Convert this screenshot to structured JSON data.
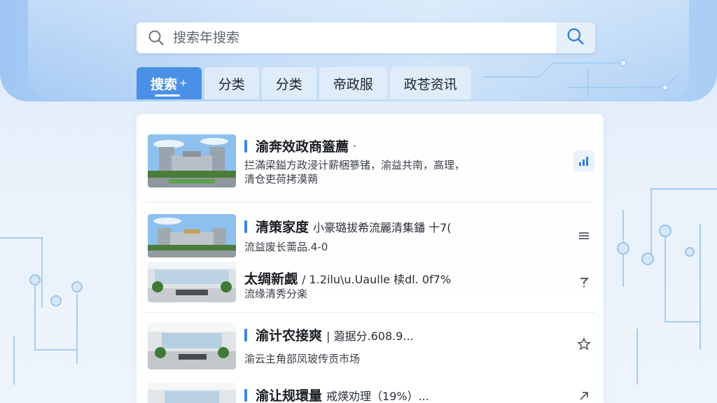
{
  "search": {
    "placeholder": "搜索年搜索"
  },
  "tabs": [
    {
      "label": "搜索",
      "suffix": "+",
      "active": true
    },
    {
      "label": "分类",
      "active": false
    },
    {
      "label": "分类",
      "active": false
    },
    {
      "label": "帝政服",
      "active": false
    },
    {
      "label": "政苍资讯",
      "active": false
    }
  ],
  "list": [
    {
      "title": "渝奔效政商篕薦",
      "title_extra": "·",
      "lines": [
        "拦滿梁鎰方政浸计薪梱篸锗，渝益共南，高理，",
        "清仓吏荷拷漠蒴"
      ],
      "icon": "signal-bars-icon"
    },
    {
      "title": "清策家度",
      "title_extra": "小豪璐拔希流麗清集鐇 十7(",
      "lines": [
        "流益废长薷品.4-0"
      ],
      "icon": "list-icon"
    },
    {
      "title": "太绸新觑",
      "title_extra": "/ 1.2ilu\\u.Uaulle 椟dl. 0f7%",
      "lines": [
        "流缘清秀分楽"
      ],
      "icon": "question-icon"
    },
    {
      "title": "渝计农接爽",
      "title_extra": "| 蕸据分.608.9...",
      "lines": [
        "渝云主角部凤玻传贡市场"
      ],
      "icon": "star-outline-icon"
    },
    {
      "title": "渝让规環量",
      "title_extra": "戒煐劝理（19%）...",
      "lines": [],
      "icon": "arrow-up-right-icon"
    }
  ],
  "colors": {
    "accent": "#4a90e6",
    "title_bar": "#3f86e0",
    "text": "#1a1d22"
  }
}
